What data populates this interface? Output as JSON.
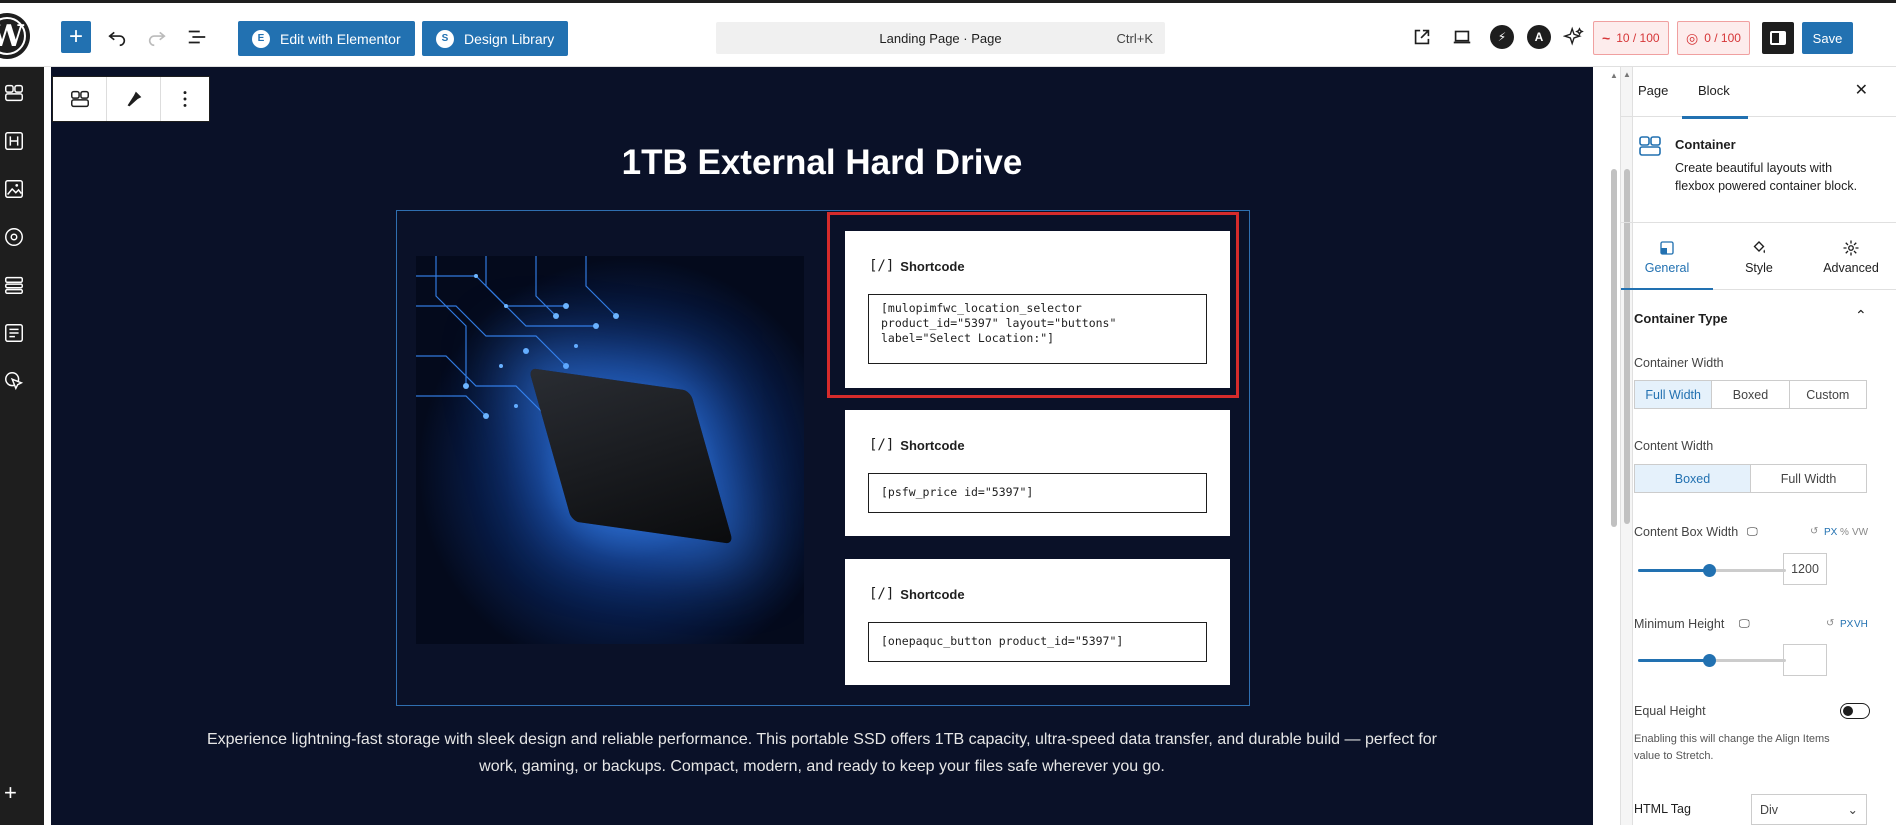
{
  "topbar": {
    "edit_elementor_label": "Edit with Elementor",
    "design_library_label": "Design Library",
    "command_title": "Landing Page · Page",
    "command_shortcut": "Ctrl+K",
    "score_a": "10 / 100",
    "score_b": "0 / 100",
    "save_label": "Save",
    "icons": [
      "wordpress-logo",
      "plus",
      "undo",
      "redo",
      "document-overview",
      "external-link",
      "desktop-preview",
      "custom-plugin-a",
      "custom-plugin-b",
      "ai-sparkle",
      "seo-score",
      "readability-score",
      "sidebar-toggle"
    ]
  },
  "leftbar": {
    "icons": [
      "container-icon",
      "heading-icon",
      "image-icon",
      "badge-icon",
      "stack-icon",
      "form-icon",
      "cursor-icon",
      "plus-icon"
    ]
  },
  "canvas": {
    "title": "1TB External Hard Drive",
    "shortcodes": [
      {
        "heading": "Shortcode",
        "code": "[mulopimfwc_location_selector\nproduct_id=\"5397\" layout=\"buttons\"\nlabel=\"Select Location:\"]"
      },
      {
        "heading": "Shortcode",
        "code": "[psfw_price id=\"5397\"]"
      },
      {
        "heading": "Shortcode",
        "code": "[onepaquc_button product_id=\"5397\"]"
      }
    ],
    "description": "Experience lightning-fast storage with sleek design and reliable performance. This portable SSD offers 1TB capacity, ultra-speed data transfer, and durable build — perfect for work, gaming, or backups. Compact, modern, and ready to keep your files safe wherever you go."
  },
  "panel": {
    "tabs": [
      "Page",
      "Block"
    ],
    "active_tab": "Block",
    "block_name": "Container",
    "block_description": "Create beautiful layouts with flexbox powered container block.",
    "settings_tabs": [
      "General",
      "Style",
      "Advanced"
    ],
    "section_title": "Container Type",
    "container_width_label": "Container Width",
    "container_width_options": [
      "Full Width",
      "Boxed",
      "Custom"
    ],
    "container_width_selected": "Full Width",
    "content_width_label": "Content Width",
    "content_width_options": [
      "Boxed",
      "Full Width"
    ],
    "content_width_selected": "Boxed",
    "content_box_width_label": "Content Box Width",
    "content_box_width_units": [
      "PX",
      "%",
      "VW"
    ],
    "content_box_width_value": "1200",
    "content_box_width_slider": 0.48,
    "min_height_label": "Minimum Height",
    "min_height_units": [
      "PX",
      "VH"
    ],
    "min_height_value": "",
    "min_height_slider": 0.48,
    "equal_height_label": "Equal Height",
    "equal_height_help": "Enabling this will change the Align Items value to Stretch.",
    "html_tag_label": "HTML Tag",
    "html_tag_value": "Div"
  },
  "colors": {
    "accent": "#2271b1",
    "canvas_bg": "#0a1128",
    "selection": "#d62b2b"
  }
}
